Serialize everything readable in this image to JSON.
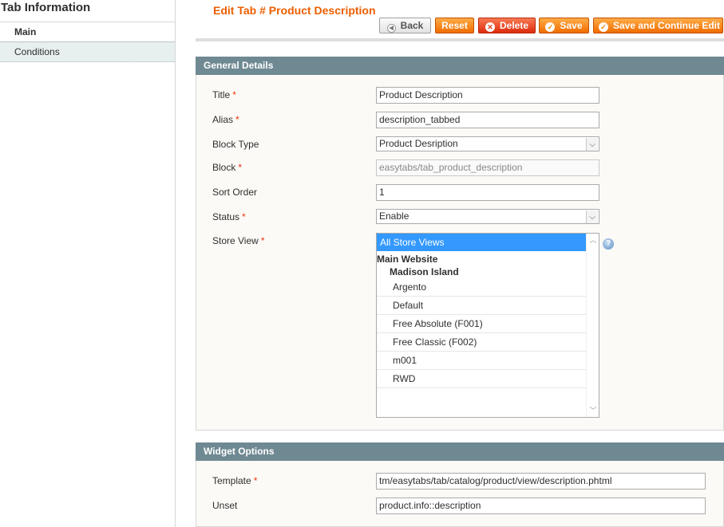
{
  "sidebar": {
    "title": "Tab Information",
    "tabs": [
      {
        "label": "Main",
        "active": true
      },
      {
        "label": "Conditions",
        "active": false
      }
    ]
  },
  "header": {
    "title": "Edit Tab # Product Description"
  },
  "toolbar": {
    "back_label": "Back",
    "reset_label": "Reset",
    "delete_label": "Delete",
    "save_label": "Save",
    "save_continue_label": "Save and Continue Edit"
  },
  "general": {
    "legend": "General Details",
    "title": {
      "label": "Title",
      "required": "*",
      "value": "Product Description"
    },
    "alias": {
      "label": "Alias",
      "required": "*",
      "value": "description_tabbed"
    },
    "block_type": {
      "label": "Block Type",
      "value": "Product Desription"
    },
    "block": {
      "label": "Block",
      "required": "*",
      "value": "easytabs/tab_product_description"
    },
    "sort_order": {
      "label": "Sort Order",
      "value": "1"
    },
    "status": {
      "label": "Status",
      "required": "*",
      "value": "Enable"
    },
    "store_view": {
      "label": "Store View",
      "required": "*",
      "selected": "All Store Views",
      "group": "Main Website",
      "subgroup": "Madison Island",
      "options": [
        "Argento",
        "Default",
        "Free Absolute (F001)",
        "Free Classic (F002)",
        "m001",
        "RWD"
      ]
    }
  },
  "widget": {
    "legend": "Widget Options",
    "template": {
      "label": "Template",
      "required": "*",
      "value": "tm/easytabs/tab/catalog/product/view/description.phtml"
    },
    "unset": {
      "label": "Unset",
      "value": "product.info::description"
    }
  },
  "colors": {
    "accent": "#eb5e00",
    "button_orange": "#f18200",
    "delete_red": "#e53b1c",
    "fieldset_header": "#6f8992",
    "selected_option": "#3399ff",
    "required": "#eb340a"
  },
  "icons": {
    "back": "arrow-left-icon",
    "delete": "close-circle-icon",
    "save": "check-circle-icon",
    "help": "help-icon"
  }
}
